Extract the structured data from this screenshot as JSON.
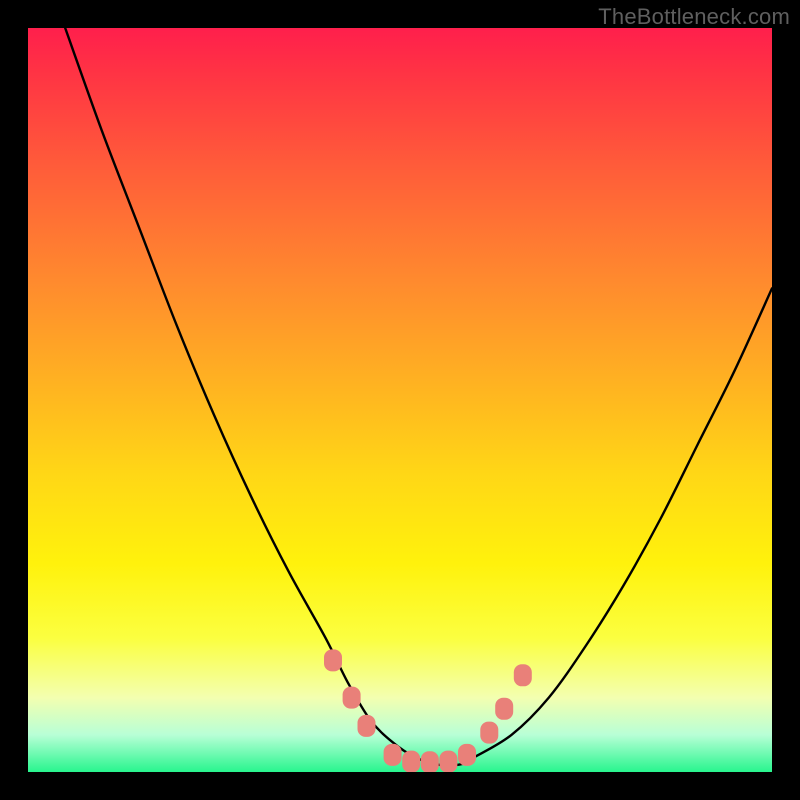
{
  "watermark": "TheBottleneck.com",
  "chart_data": {
    "type": "line",
    "title": "",
    "xlabel": "",
    "ylabel": "",
    "xlim": [
      0,
      100
    ],
    "ylim": [
      0,
      100
    ],
    "series": [
      {
        "name": "bottleneck-curve",
        "x": [
          5,
          10,
          15,
          20,
          25,
          30,
          35,
          40,
          43,
          46,
          49,
          52,
          55,
          58,
          60,
          65,
          70,
          75,
          80,
          85,
          90,
          95,
          100
        ],
        "y": [
          100,
          86,
          73,
          60,
          48,
          37,
          27,
          18,
          12,
          7,
          4,
          2,
          1,
          1,
          2,
          5,
          10,
          17,
          25,
          34,
          44,
          54,
          65
        ]
      }
    ],
    "markers": {
      "name": "threshold-markers",
      "shape": "rounded-rect",
      "color": "#e98079",
      "points": [
        {
          "x": 41,
          "y": 15
        },
        {
          "x": 43.5,
          "y": 10
        },
        {
          "x": 45.5,
          "y": 6.2
        },
        {
          "x": 49,
          "y": 2.3
        },
        {
          "x": 51.5,
          "y": 1.4
        },
        {
          "x": 54,
          "y": 1.3
        },
        {
          "x": 56.5,
          "y": 1.4
        },
        {
          "x": 59,
          "y": 2.3
        },
        {
          "x": 62,
          "y": 5.3
        },
        {
          "x": 64,
          "y": 8.5
        },
        {
          "x": 66.5,
          "y": 13
        }
      ]
    }
  }
}
